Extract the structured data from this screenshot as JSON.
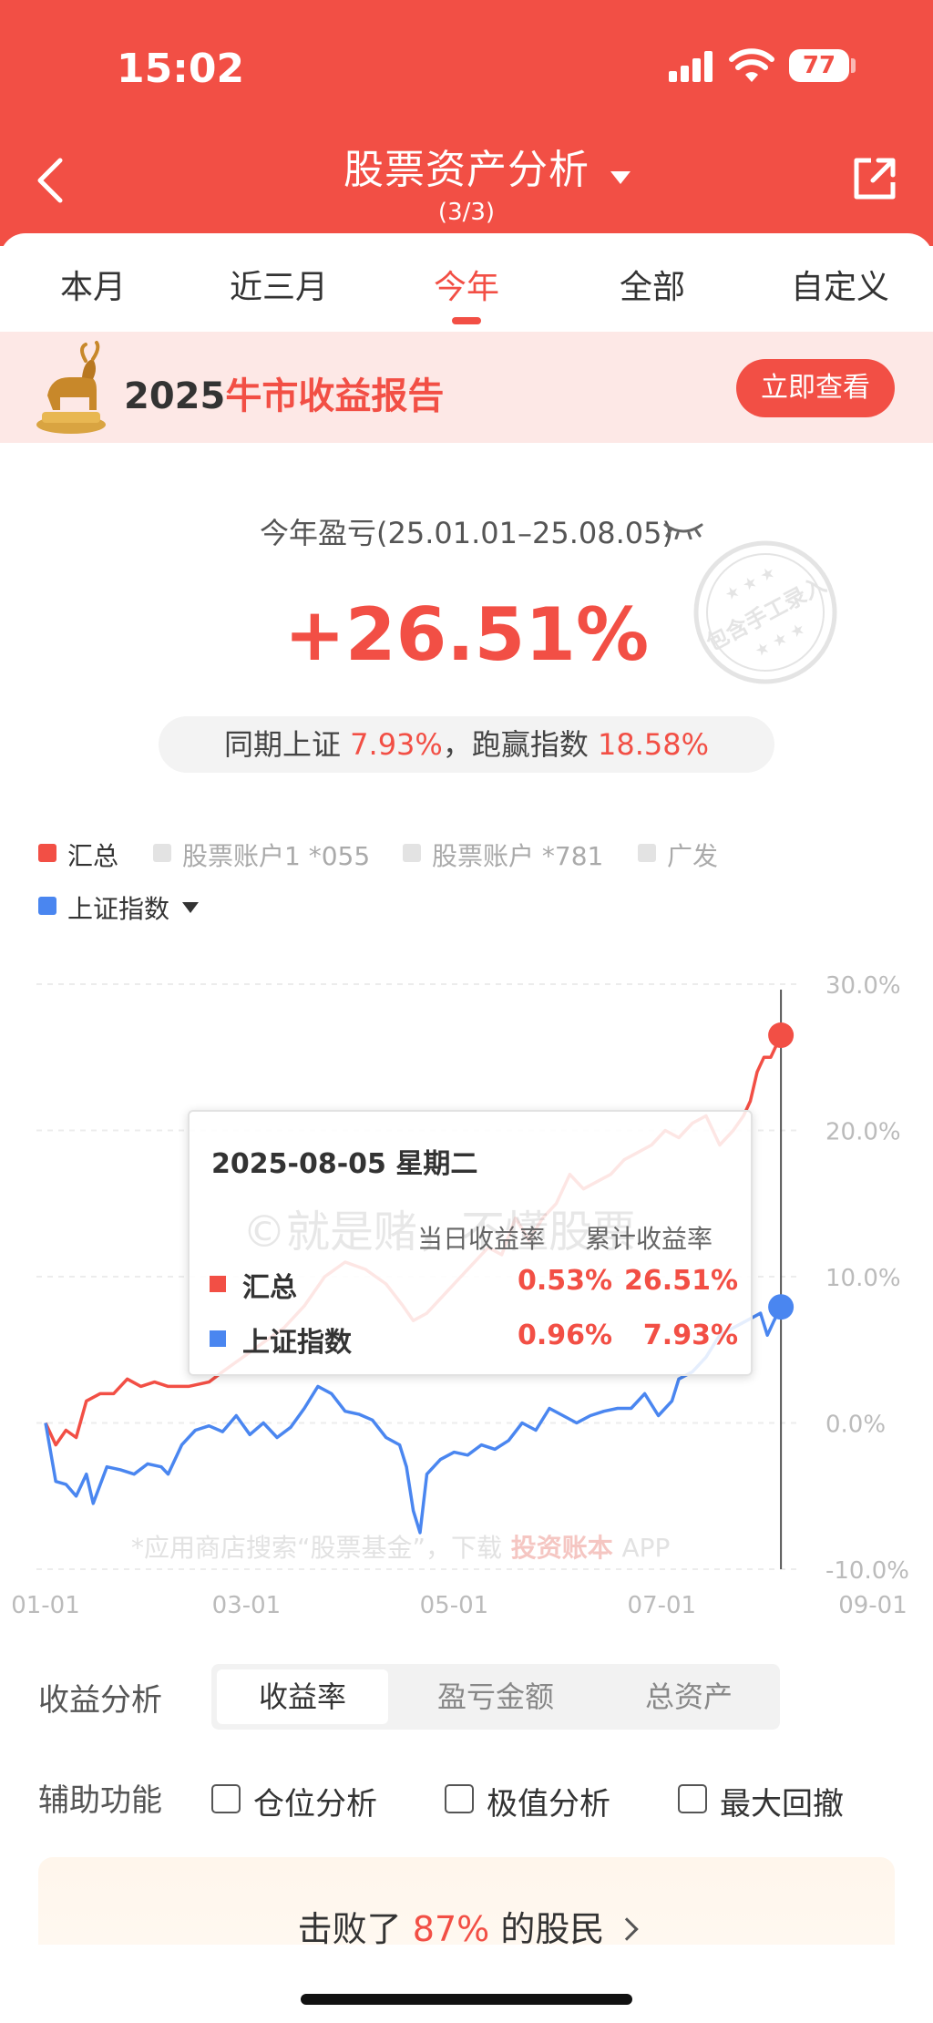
{
  "status_bar": {
    "time": "15:02",
    "battery": "77"
  },
  "header": {
    "title": "股票资产分析",
    "subtitle": "(3/3)"
  },
  "tabs": [
    {
      "label": "本月",
      "active": false
    },
    {
      "label": "近三月",
      "active": false
    },
    {
      "label": "今年",
      "active": true
    },
    {
      "label": "全部",
      "active": false
    },
    {
      "label": "自定义",
      "active": false
    }
  ],
  "banner": {
    "year": "2025",
    "title": "牛市收益报告",
    "button": "立即查看"
  },
  "summary": {
    "label": "今年盈亏(25.01.01–25.08.05)",
    "value": "+26.51%",
    "stamp_text": "包含手工录入",
    "compare_prefix": "同期上证",
    "compare_index": "7.93%",
    "compare_mid": "，跑赢指数",
    "compare_beat": "18.58%"
  },
  "legend": {
    "items": [
      {
        "label": "汇总",
        "color": "#f24f45",
        "active": true
      },
      {
        "label": "股票账户1 *055",
        "color": "#e3e3e3",
        "active": false
      },
      {
        "label": "股票账户 *781",
        "color": "#e3e3e3",
        "active": false
      },
      {
        "label": "广发",
        "color": "#e3e3e3",
        "active": false
      }
    ],
    "index": {
      "label": "上证指数",
      "color": "#4a86f0"
    }
  },
  "chart_data": {
    "type": "line",
    "x_ticks": [
      "01-01",
      "03-01",
      "05-01",
      "07-01",
      "09-01"
    ],
    "y_ticks": [
      "30.0%",
      "20.0%",
      "10.0%",
      "0.0%",
      "-10.0%"
    ],
    "ylim": [
      -10,
      30
    ],
    "x_unit": "day of year 2025",
    "series": [
      {
        "name": "汇总",
        "color": "#f24f45",
        "points": [
          [
            0,
            0.0
          ],
          [
            3,
            -1.5
          ],
          [
            6,
            -0.5
          ],
          [
            9,
            -1.0
          ],
          [
            12,
            1.5
          ],
          [
            16,
            2.0
          ],
          [
            20,
            2.0
          ],
          [
            24,
            3.0
          ],
          [
            28,
            2.5
          ],
          [
            32,
            2.8
          ],
          [
            36,
            2.5
          ],
          [
            42,
            2.5
          ],
          [
            48,
            2.8
          ],
          [
            52,
            3.5
          ],
          [
            58,
            4.5
          ],
          [
            64,
            5.5
          ],
          [
            70,
            6.5
          ],
          [
            76,
            8.0
          ],
          [
            82,
            10.0
          ],
          [
            88,
            11.0
          ],
          [
            94,
            10.5
          ],
          [
            100,
            9.5
          ],
          [
            105,
            8.0
          ],
          [
            108,
            7.0
          ],
          [
            112,
            7.5
          ],
          [
            118,
            9.0
          ],
          [
            124,
            10.5
          ],
          [
            130,
            12.0
          ],
          [
            134,
            11.5
          ],
          [
            138,
            14.0
          ],
          [
            142,
            12.5
          ],
          [
            146,
            14.0
          ],
          [
            150,
            15.0
          ],
          [
            154,
            17.0
          ],
          [
            158,
            16.0
          ],
          [
            162,
            16.5
          ],
          [
            166,
            17.0
          ],
          [
            170,
            18.0
          ],
          [
            174,
            18.5
          ],
          [
            178,
            19.0
          ],
          [
            182,
            20.0
          ],
          [
            186,
            19.5
          ],
          [
            190,
            20.5
          ],
          [
            194,
            21.0
          ],
          [
            198,
            19.0
          ],
          [
            202,
            20.0
          ],
          [
            205,
            21.0
          ],
          [
            207,
            22.0
          ],
          [
            209,
            24.0
          ],
          [
            211,
            25.0
          ],
          [
            213,
            25.0
          ],
          [
            215,
            26.0
          ],
          [
            216,
            26.51
          ]
        ]
      },
      {
        "name": "上证指数",
        "color": "#4a86f0",
        "points": [
          [
            0,
            0.0
          ],
          [
            3,
            -4.0
          ],
          [
            6,
            -4.2
          ],
          [
            9,
            -5.0
          ],
          [
            12,
            -3.5
          ],
          [
            14,
            -5.5
          ],
          [
            18,
            -3.0
          ],
          [
            22,
            -3.2
          ],
          [
            26,
            -3.5
          ],
          [
            30,
            -2.8
          ],
          [
            34,
            -3.0
          ],
          [
            36,
            -3.5
          ],
          [
            40,
            -1.5
          ],
          [
            44,
            -0.5
          ],
          [
            48,
            -0.2
          ],
          [
            52,
            -0.6
          ],
          [
            56,
            0.5
          ],
          [
            60,
            -0.8
          ],
          [
            64,
            0.0
          ],
          [
            68,
            -1.0
          ],
          [
            72,
            -0.3
          ],
          [
            76,
            1.0
          ],
          [
            80,
            2.5
          ],
          [
            84,
            2.0
          ],
          [
            88,
            0.8
          ],
          [
            92,
            0.6
          ],
          [
            96,
            0.2
          ],
          [
            100,
            -1.0
          ],
          [
            104,
            -1.5
          ],
          [
            106,
            -3.0
          ],
          [
            108,
            -6.0
          ],
          [
            110,
            -7.5
          ],
          [
            112,
            -3.5
          ],
          [
            116,
            -2.5
          ],
          [
            120,
            -2.0
          ],
          [
            124,
            -2.2
          ],
          [
            128,
            -1.5
          ],
          [
            132,
            -1.8
          ],
          [
            136,
            -1.2
          ],
          [
            140,
            0.0
          ],
          [
            144,
            -0.5
          ],
          [
            148,
            1.0
          ],
          [
            152,
            0.5
          ],
          [
            156,
            0.0
          ],
          [
            160,
            0.5
          ],
          [
            164,
            0.8
          ],
          [
            168,
            1.0
          ],
          [
            172,
            1.0
          ],
          [
            176,
            2.0
          ],
          [
            180,
            0.5
          ],
          [
            184,
            1.5
          ],
          [
            186,
            3.0
          ],
          [
            190,
            3.5
          ],
          [
            194,
            4.5
          ],
          [
            198,
            6.0
          ],
          [
            202,
            6.5
          ],
          [
            206,
            7.0
          ],
          [
            210,
            7.5
          ],
          [
            212,
            6.0
          ],
          [
            214,
            7.0
          ],
          [
            216,
            7.93
          ]
        ]
      }
    ],
    "marker_day": 216
  },
  "tooltip": {
    "date": "2025-08-05 星期二",
    "col1": "当日收益率",
    "col2": "累计收益率",
    "watermark": "©就是赌，不懂股票",
    "rows": [
      {
        "name": "汇总",
        "color": "#f24f45",
        "daily": "0.53%",
        "cumulative": "26.51%"
      },
      {
        "name": "上证指数",
        "color": "#4a86f0",
        "daily": "0.96%",
        "cumulative": "7.93%"
      }
    ]
  },
  "chart_footer": {
    "prefix": "*应用商店搜索“股票基金”，下载",
    "brand": "投资账本",
    "suffix": "APP"
  },
  "analysis": {
    "label": "收益分析",
    "segments": [
      {
        "label": "收益率",
        "active": true
      },
      {
        "label": "盈亏金额",
        "active": false
      },
      {
        "label": "总资产",
        "active": false
      }
    ]
  },
  "aux": {
    "label": "辅助功能",
    "options": [
      {
        "label": "仓位分析",
        "checked": false
      },
      {
        "label": "极值分析",
        "checked": false
      },
      {
        "label": "最大回撤",
        "checked": false
      }
    ]
  },
  "beat": {
    "prefix": "击败了",
    "percent": "87%",
    "suffix": "的股民"
  }
}
